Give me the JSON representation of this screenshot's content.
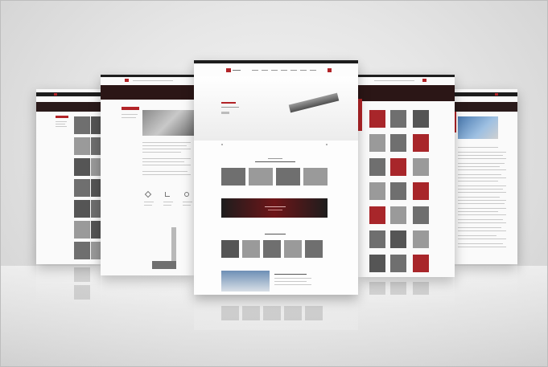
{
  "mockup": {
    "screens": [
      {
        "name": "far-left-screen"
      },
      {
        "name": "left-screen"
      },
      {
        "name": "center-screen"
      },
      {
        "name": "right-screen"
      },
      {
        "name": "far-right-screen"
      }
    ],
    "colors": {
      "brand_red": "#b22327",
      "dark_bar": "#1e1e1e",
      "background": "#e6e6e6"
    }
  }
}
